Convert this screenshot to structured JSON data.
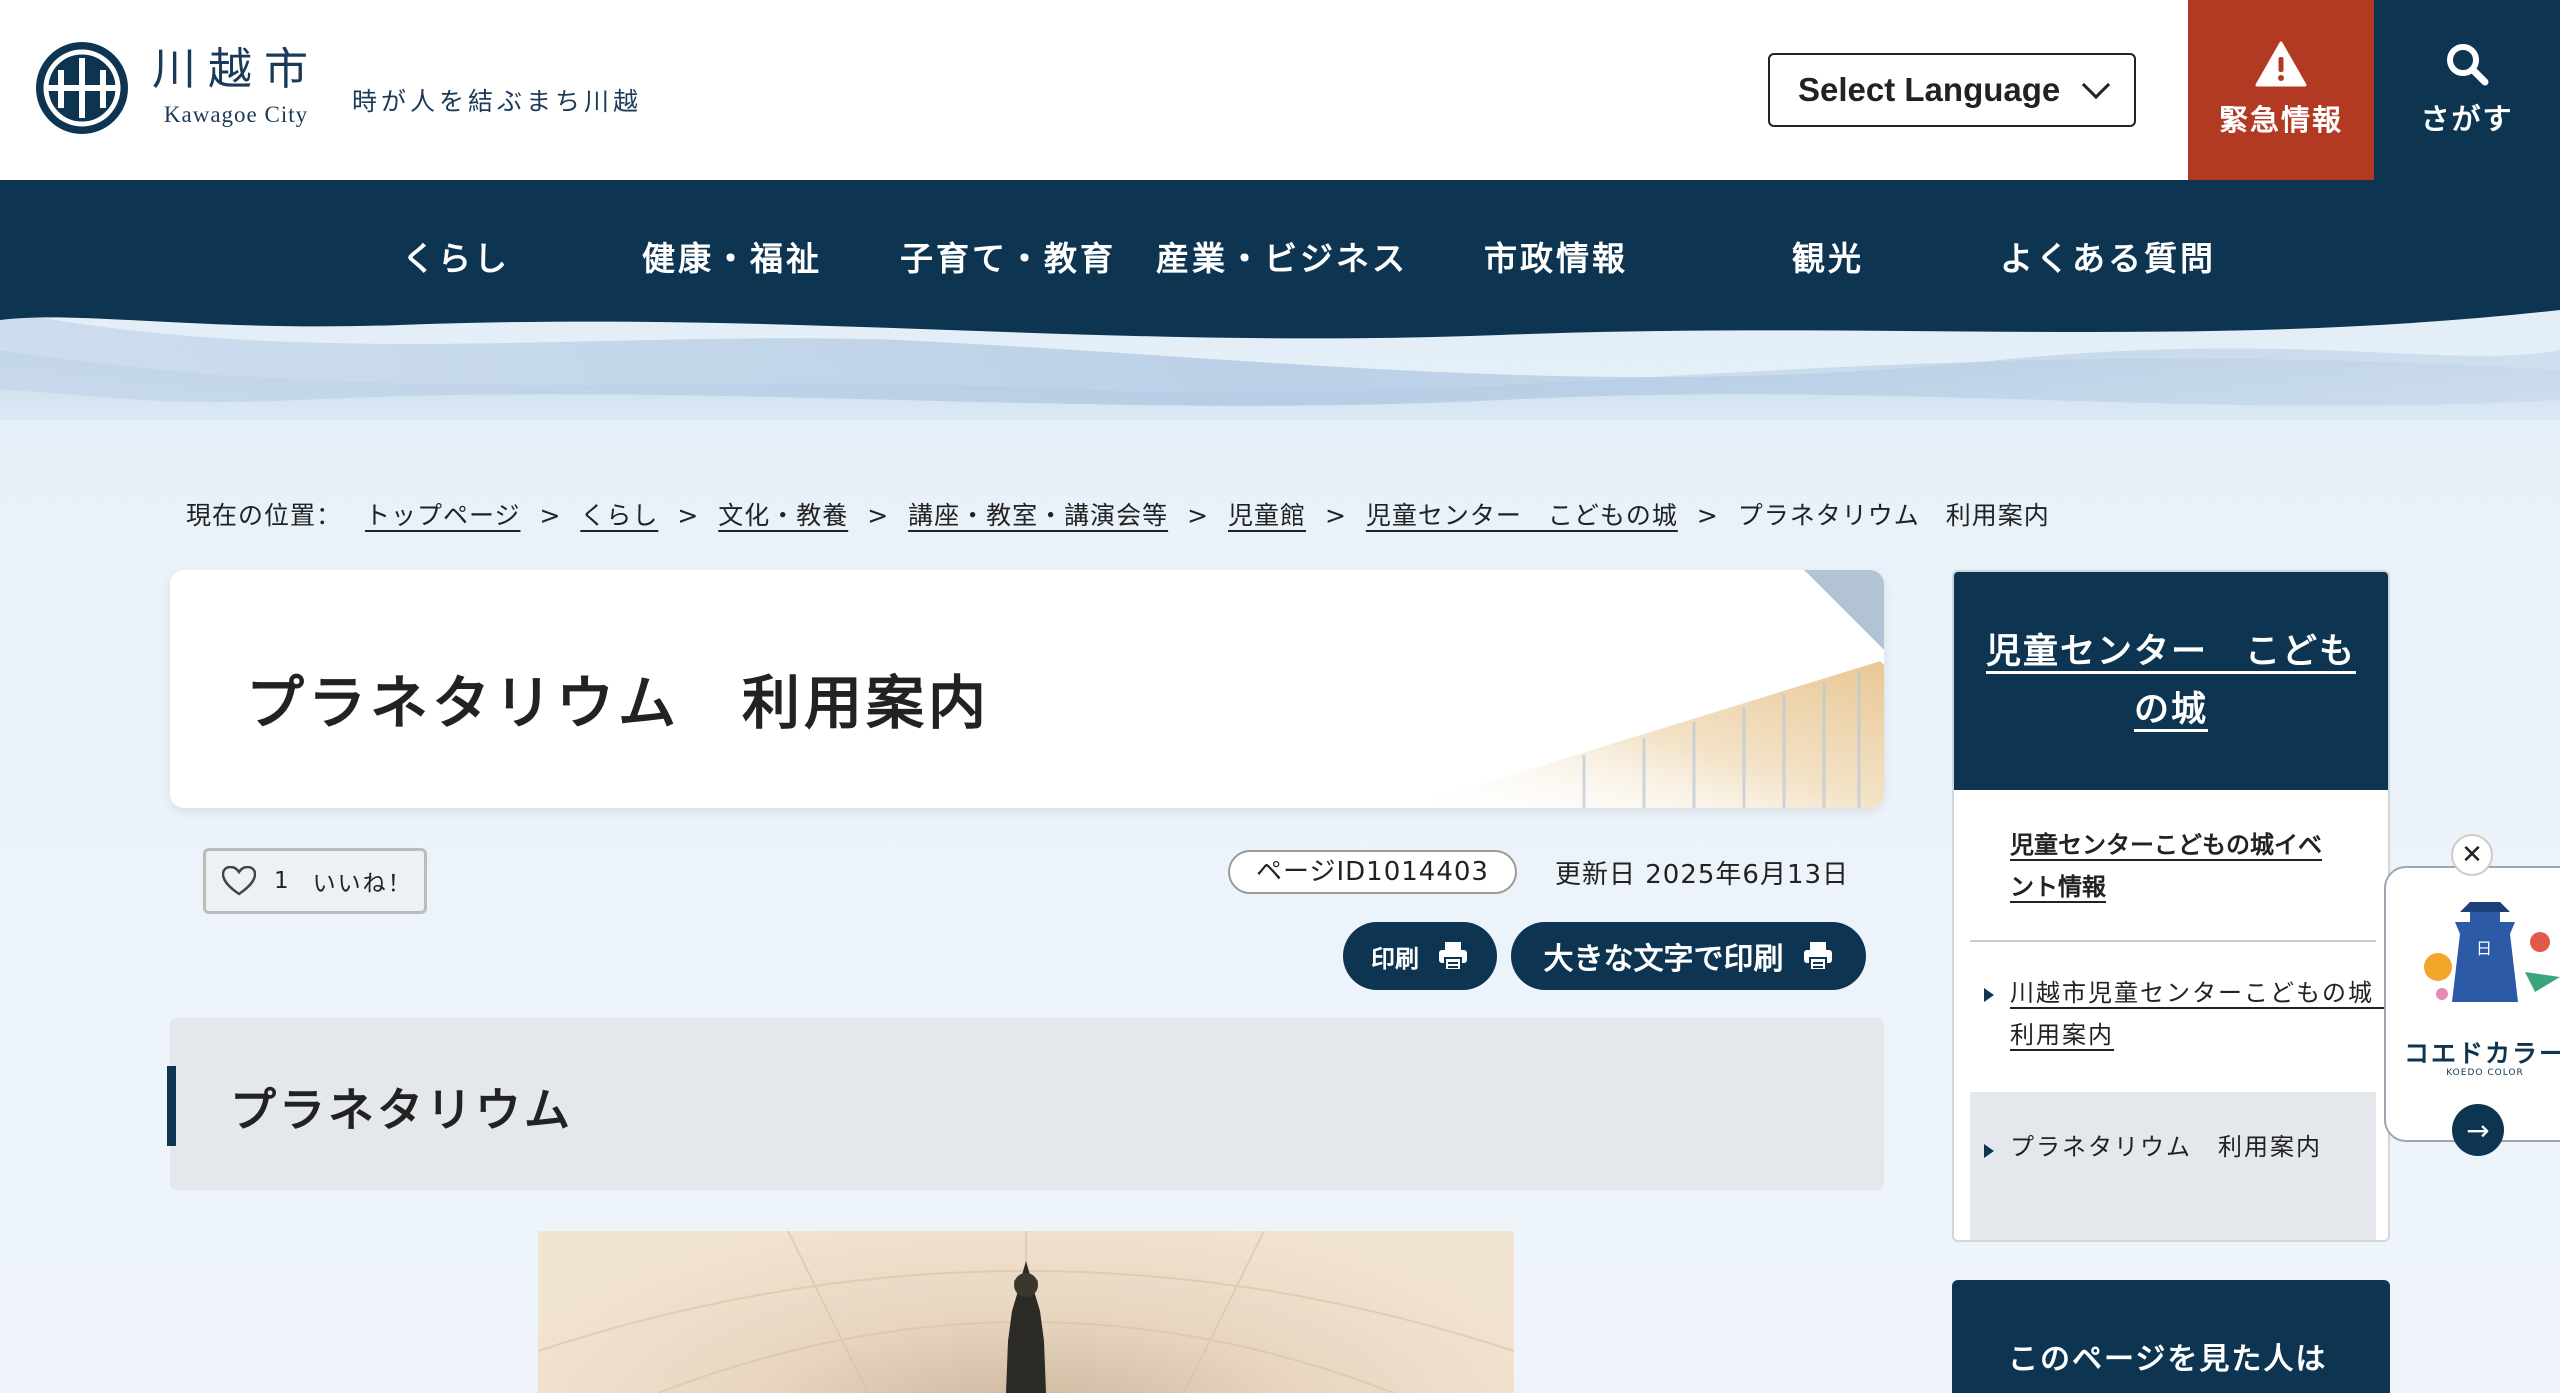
{
  "header": {
    "logo_jp": "川越市",
    "logo_en": "Kawagoe City",
    "tagline": "時が人を結ぶまち川越",
    "language_select": "Select Language",
    "emergency_label": "緊急情報",
    "search_label": "さがす"
  },
  "nav": {
    "items": [
      "くらし",
      "健康・福祉",
      "子育て・教育",
      "産業・ビジネス",
      "市政情報",
      "観光",
      "よくある質問"
    ]
  },
  "breadcrumb": {
    "lead": "現在の位置：",
    "links": [
      "トップページ",
      "くらし",
      "文化・教養",
      "講座・教室・講演会等",
      "児童館",
      "児童センター　こどもの城"
    ],
    "separator": ">",
    "current": "プラネタリウム　利用案内"
  },
  "page": {
    "title": "プラネタリウム　利用案内",
    "like_count": "1",
    "like_label": "いいね！",
    "page_id": "ページID1014403",
    "updated": "更新日 2025年6月13日",
    "print_label": "印刷",
    "print_large_label": "大きな文字で印刷",
    "section_heading": "プラネタリウム"
  },
  "sidebar": {
    "heading": "児童センター　こどもの城",
    "event_link": "児童センターこどもの城イベント情報",
    "items": [
      "川越市児童センターこどもの城　利用案内",
      "プラネタリウム　利用案内"
    ],
    "second_heading": "このページを見た人は"
  },
  "float_banner": {
    "close": "✕",
    "title": "コエドカラー",
    "subtitle": "KOEDO COLOR",
    "arrow": "→"
  },
  "colors": {
    "navy": "#0d3552",
    "emergency": "#b23a22",
    "section_bg": "#e4e8ec"
  }
}
